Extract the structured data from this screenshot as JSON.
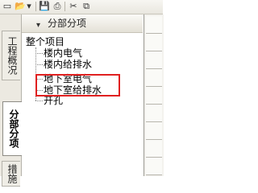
{
  "toolbar": {
    "icons": [
      "new-doc-icon",
      "open-icon",
      "dropdown-icon",
      "save-icon",
      "print-icon",
      "cut-icon",
      "copy-icon"
    ],
    "glyphs": [
      "▭",
      "📂",
      "▾",
      "💾",
      "⎙",
      "✂",
      "⧉"
    ]
  },
  "left_tabs": [
    {
      "label": "工程概况",
      "active": false
    },
    {
      "label": "分部分项",
      "active": true
    },
    {
      "label": "措施",
      "active": false
    }
  ],
  "panel": {
    "title": "分部分项",
    "dropdown_glyph": "▾"
  },
  "tree": {
    "root": "整个项目",
    "children": [
      "楼内电气",
      "楼内给排水",
      "地下室电气",
      "地下室给排水",
      "开孔"
    ]
  },
  "right_grid": {
    "cells": [
      "",
      "",
      "",
      "",
      "",
      "",
      "",
      "",
      "",
      ""
    ]
  },
  "colors": {
    "highlight": "#e02020"
  }
}
